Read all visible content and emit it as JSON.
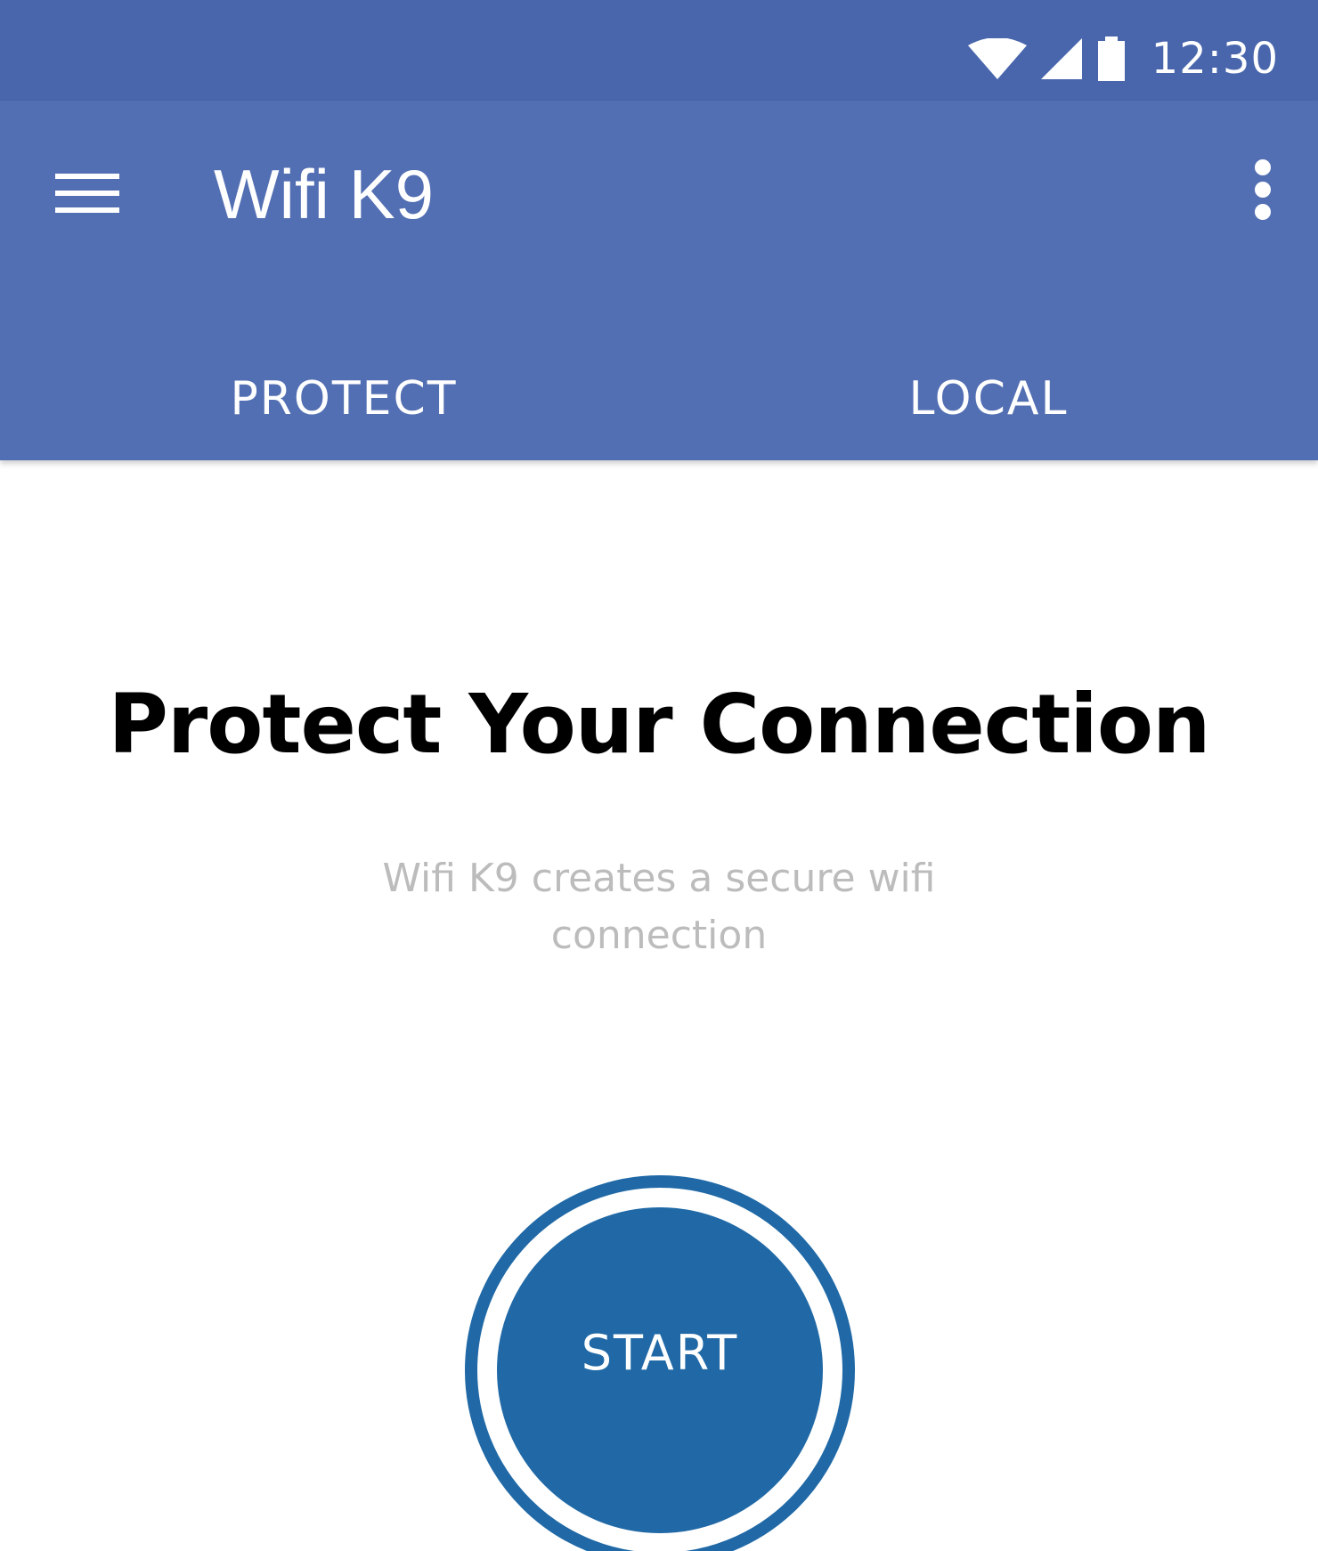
{
  "status_bar": {
    "time": "12:30",
    "icons": [
      "wifi-icon",
      "cellular-signal-icon",
      "battery-icon"
    ],
    "background": "#4966ad"
  },
  "app_bar": {
    "title": "Wifi K9",
    "menu_icon": "hamburger-menu-icon",
    "overflow_icon": "more-vert-icon",
    "background": "#536fb3"
  },
  "tabs": [
    {
      "label": "PROTECT"
    },
    {
      "label": "LOCAL"
    }
  ],
  "main": {
    "headline": "Protect Your Connection",
    "subtitle": "Wifi K9 creates a secure wifi connection",
    "start_label": "START",
    "accent": "#2069a6"
  }
}
